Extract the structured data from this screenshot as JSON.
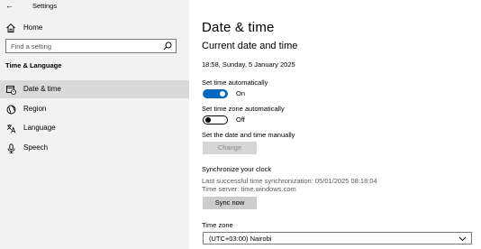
{
  "window": {
    "back_glyph": "←",
    "title": "Settings"
  },
  "sidebar": {
    "home_label": "Home",
    "search_placeholder": "Find a setting",
    "section_header": "Time & Language",
    "items": [
      {
        "label": "Date & time",
        "icon": "calendar-clock-icon",
        "active": true
      },
      {
        "label": "Region",
        "icon": "globe-icon",
        "active": false
      },
      {
        "label": "Language",
        "icon": "language-icon",
        "active": false
      },
      {
        "label": "Speech",
        "icon": "microphone-icon",
        "active": false
      }
    ]
  },
  "main": {
    "title": "Date & time",
    "subtitle": "Current date and time",
    "current_datetime": "18:58, Sunday, 5 January 2025",
    "set_time_auto": {
      "label": "Set time automatically",
      "state": "On",
      "on": true
    },
    "set_timezone_auto": {
      "label": "Set time zone automatically",
      "state": "Off",
      "on": false
    },
    "manual": {
      "label": "Set the date and time manually",
      "button": "Change"
    },
    "sync": {
      "title": "Synchronize your clock",
      "last_sync": "Last successful time synchronization: 05/01/2025 08:18:04",
      "server": "Time server: time.windows.com",
      "button": "Sync now"
    },
    "timezone": {
      "label": "Time zone",
      "value": "(UTC+03:00) Nairobi"
    }
  },
  "colors": {
    "accent": "#0067c0",
    "sidebar_bg": "#f2f2f2",
    "active_item_bg": "#d9d9d9",
    "button_bg": "#cccccc"
  }
}
